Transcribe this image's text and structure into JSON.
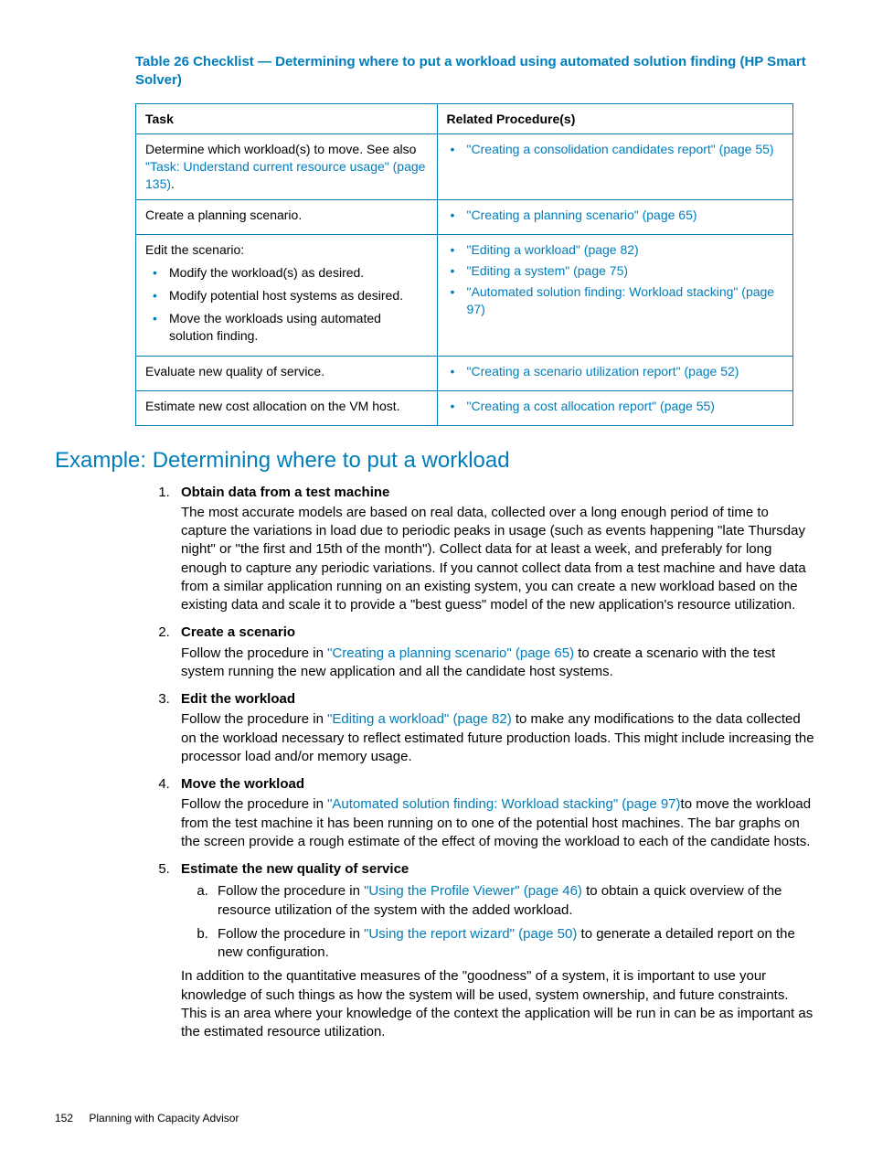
{
  "page_number": "152",
  "footer_text": "Planning with Capacity Advisor",
  "table_title": "Table 26 Checklist — Determining where to put a workload using automated solution finding (HP Smart Solver)",
  "table": {
    "headers": {
      "task": "Task",
      "related": "Related Procedure(s)"
    },
    "rows": [
      {
        "task_text_1": "Determine which workload(s) to move. See also ",
        "task_link_1": "\"Task: Understand current resource usage\" (page 135)",
        "task_text_2": ".",
        "related_items": [
          {
            "text": "\"Creating a consolidation candidates report\" (page 55)"
          }
        ]
      },
      {
        "task_text_1": "Create a planning scenario.",
        "related_items": [
          {
            "text": "\"Creating a planning scenario\" (page 65)"
          }
        ]
      },
      {
        "task_text_1": "Edit the scenario:",
        "task_sub": [
          "Modify the workload(s) as desired.",
          "Modify potential host systems as desired.",
          "Move the workloads using automated solution finding."
        ],
        "related_items": [
          {
            "text": "\"Editing a workload\" (page 82)"
          },
          {
            "text": "\"Editing a system\" (page 75)"
          },
          {
            "text": "\"Automated solution finding: Workload stacking\" (page 97)"
          }
        ]
      },
      {
        "task_text_1": "Evaluate new quality of service.",
        "related_items": [
          {
            "text": "\"Creating a scenario utilization report\" (page 52)"
          }
        ]
      },
      {
        "task_text_1": "Estimate new cost allocation on the VM host.",
        "related_items": [
          {
            "text": "\"Creating a cost allocation report\" (page 55)"
          }
        ]
      }
    ]
  },
  "example_heading": "Example: Determining where to put a workload",
  "steps": [
    {
      "title": "Obtain data from a test machine",
      "body_pre": "The most accurate models are based on real data, collected over a long enough period of time to capture the variations in load due to periodic peaks in usage (such as events happening \"late Thursday night\" or \"the first and 15th of the month\"). Collect data for at least a week, and preferably for long enough to capture any periodic variations. If you cannot collect data from a test machine and have data from a similar application running on an existing system, you can create a new workload based on the existing data and scale it to provide a \"best guess\" model of the new application's resource utilization."
    },
    {
      "title": "Create a scenario",
      "body_pre": "Follow the procedure in ",
      "body_link": "\"Creating a planning scenario\" (page 65)",
      "body_post": " to create a scenario with the test system running the new application and all the candidate host systems."
    },
    {
      "title": "Edit the workload",
      "body_pre": "Follow the procedure in ",
      "body_link": "\"Editing a workload\" (page 82)",
      "body_post": " to make any modifications to the data collected on the workload necessary to reflect estimated future production loads. This might include increasing the processor load and/or memory usage."
    },
    {
      "title": "Move the workload",
      "body_pre": "Follow the procedure in ",
      "body_link": "\"Automated solution finding: Workload stacking\" (page 97)",
      "body_post": "to move the workload from the test machine it has been running on to one of the potential host machines. The bar graphs on the screen provide a rough estimate of the effect of moving the workload to each of the candidate hosts."
    },
    {
      "title": "Estimate the new quality of service",
      "substeps": [
        {
          "pre": "Follow the procedure in ",
          "link": "\"Using the Profile Viewer\" (page 46)",
          "post": " to obtain a quick overview of the resource utilization of the system with the added workload."
        },
        {
          "pre": "Follow the procedure in ",
          "link": "\"Using the report wizard\" (page 50)",
          "post": " to generate a detailed report on the new configuration."
        }
      ],
      "tail": "In addition to the quantitative measures of the \"goodness\" of a system, it is important to use your knowledge of such things as how the system will be used, system ownership, and future constraints. This is an area where your knowledge of the context the application will be run in can be as important as the estimated resource utilization."
    }
  ]
}
